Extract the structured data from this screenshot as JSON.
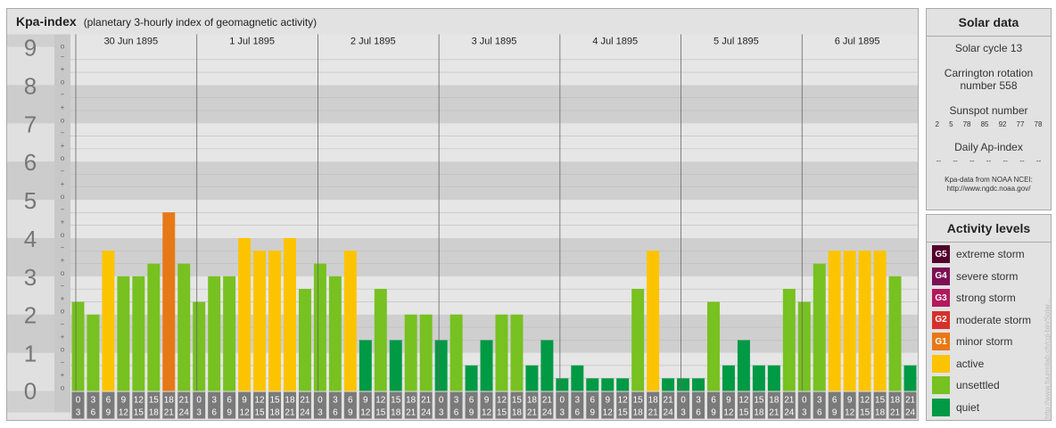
{
  "header": {
    "title": "Kpa-index",
    "subtitle": "(planetary 3-hourly index of geomagnetic activity)"
  },
  "chart_data": {
    "type": "bar",
    "title": "Kpa-index",
    "subtitle": "(planetary 3-hourly index of geomagnetic activity)",
    "ylim": [
      0,
      9
    ],
    "y_ticks": [
      "0",
      "1",
      "2",
      "3",
      "4",
      "5",
      "6",
      "7",
      "8",
      "9"
    ],
    "minor_ticks": [
      "o",
      "+",
      "−"
    ],
    "days": [
      "30 Jun 1895",
      "1 Jul 1895",
      "2 Jul 1895",
      "3 Jul 1895",
      "4 Jul 1895",
      "5 Jul 1895",
      "6 Jul 1895"
    ],
    "interval_top": [
      "0",
      "3",
      "6",
      "9",
      "12",
      "15",
      "18",
      "21"
    ],
    "interval_bottom": [
      "3",
      "6",
      "9",
      "12",
      "15",
      "18",
      "21",
      "24"
    ],
    "values": [
      [
        2.33,
        2.0,
        3.67,
        3.0,
        3.0,
        3.33,
        4.67,
        3.33
      ],
      [
        2.33,
        3.0,
        3.0,
        4.0,
        3.67,
        3.67,
        4.0,
        2.67
      ],
      [
        3.33,
        3.0,
        3.67,
        1.33,
        2.67,
        1.33,
        2.0,
        2.0
      ],
      [
        1.33,
        2.0,
        0.67,
        1.33,
        2.0,
        2.0,
        0.67,
        1.33
      ],
      [
        0.33,
        0.67,
        0.33,
        0.33,
        0.33,
        2.67,
        3.67,
        0.33
      ],
      [
        0.33,
        0.33,
        2.33,
        0.67,
        1.33,
        0.67,
        0.67,
        2.67
      ],
      [
        2.33,
        3.33,
        3.67,
        3.67,
        3.67,
        3.67,
        3.0,
        0.67
      ]
    ],
    "colors": {
      "quiet": "#009944",
      "unsettled": "#77c121",
      "active": "#fcc400",
      "minor": "#e77817"
    }
  },
  "solar": {
    "title": "Solar data",
    "cycle": "Solar cycle 13",
    "carrington_1": "Carrington rotation",
    "carrington_2": "number 558",
    "sunspot_title": "Sunspot number",
    "sunspots": [
      "2",
      "5",
      "78",
      "85",
      "92",
      "77",
      "78"
    ],
    "ap_title": "Daily Ap-index",
    "ap": [
      "--",
      "--",
      "--",
      "--",
      "--",
      "--",
      "--"
    ],
    "credit_1": "Kpa-data from NOAA NCEI:",
    "credit_2": "http://www.ngdc.noaa.gov/"
  },
  "activity": {
    "title": "Activity levels",
    "items": [
      {
        "code": "G5",
        "label": "extreme storm",
        "color": "#53002c"
      },
      {
        "code": "G4",
        "label": "severe storm",
        "color": "#7c0f56"
      },
      {
        "code": "G3",
        "label": "strong storm",
        "color": "#b3195d"
      },
      {
        "code": "G2",
        "label": "moderate storm",
        "color": "#d5312c"
      },
      {
        "code": "G1",
        "label": "minor storm",
        "color": "#e77817"
      },
      {
        "code": "",
        "label": "active",
        "color": "#fcc400"
      },
      {
        "code": "",
        "label": "unsettled",
        "color": "#77c121"
      },
      {
        "code": "",
        "label": "quiet",
        "color": "#009944"
      }
    ]
  },
  "watermark": "http://www.fourmilab.ch/cgi-bin/Solar..."
}
